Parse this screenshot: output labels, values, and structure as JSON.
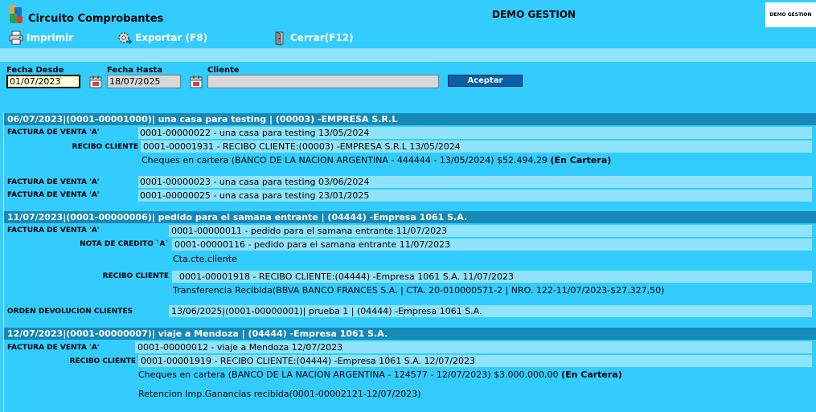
{
  "window": {
    "title": "Circuito Comprobantes",
    "company": "DEMO GESTION",
    "logo_text": "DEMO GESTION"
  },
  "toolbar": {
    "print_label": "Imprimir",
    "export_label": "Exportar (F8)",
    "close_label": "Cerrar(F12)"
  },
  "filters": {
    "fecha_desde_label": "Fecha Desde",
    "fecha_desde_value": "01/07/2023",
    "fecha_hasta_label": "Fecha Hasta",
    "fecha_hasta_value": "18/07/2025",
    "cliente_label": "Cliente",
    "cliente_value": "",
    "accept_label": "Aceptar"
  },
  "groups": [
    {
      "header": "06/07/2023|(0001-00001000)| una casa para testing | (00003) -EMPRESA S.R.L",
      "rows": [
        {
          "label": "FACTURA DE VENTA 'A'",
          "text": "0001-00000022 - una casa para testing 13/05/2024"
        },
        {
          "label": "RECIBO CLIENTE",
          "text": "0001-00001931 - RECIBO CLIENTE:(00003) -EMPRESA S.R.L 13/05/2024"
        },
        {
          "label": "",
          "text": "Cheques en cartera (BANCO DE LA NACION ARGENTINA - 444444 - 13/05/2024) $52.494,29",
          "status": "(En Cartera)"
        },
        {
          "label": "FACTURA DE VENTA 'A'",
          "text": "0001-00000023 - una casa para testing 03/06/2024"
        },
        {
          "label": "FACTURA DE VENTA 'A'",
          "text": "0001-00000025 - una casa para testing 23/01/2025"
        }
      ]
    },
    {
      "header": "11/07/2023|(0001-00000006)| pedido para el samana entrante | (04444) -Empresa 1061 S.A.",
      "rows": [
        {
          "label": "FACTURA DE VENTA 'A'",
          "text": "0001-00000011 - pedido para el samana entrante 11/07/2023"
        },
        {
          "label": "NOTA DE CREDITO `A`",
          "text": "0001-00000116 - pedido para el samana entrante 11/07/2023"
        },
        {
          "label": "",
          "text": "Cta.cte.cliente"
        },
        {
          "label": "RECIBO CLIENTE",
          "text": "0001-00001918 - RECIBO CLIENTE:(04444) -Empresa 1061 S.A. 11/07/2023"
        },
        {
          "label": "",
          "text": "Transferencia Recibida(BBVA BANCO FRANCES S.A. | CTA. 20-010000571-2 | NRO. 122-11/07/2023-$27.327,50)"
        },
        {
          "label": "ORDEN DEVOLUCION CLIENTES",
          "text": "13/06/2025|(0001-00000001)| prueba 1 | (04444) -Empresa 1061 S.A."
        }
      ]
    },
    {
      "header": "12/07/2023|(0001-00000007)| viaje a Mendoza | (04444) -Empresa 1061 S.A.",
      "rows": [
        {
          "label": "FACTURA DE VENTA 'A'",
          "text": "0001-00000012 - viaje a Mendoza 12/07/2023"
        },
        {
          "label": "RECIBO CLIENTE",
          "text": "0001-00001919 - RECIBO CLIENTE:(04444) -Empresa 1061 S.A. 12/07/2023"
        },
        {
          "label": "",
          "text": "Cheques en cartera (BANCO DE LA NACION ARGENTINA - 124577 - 12/07/2023) $3.000.000,00",
          "status": "(En Cartera)"
        },
        {
          "label": "",
          "text": "Retencion Imp.Ganancias recibida(0001-00002121-12/07/2023)"
        }
      ]
    }
  ]
}
